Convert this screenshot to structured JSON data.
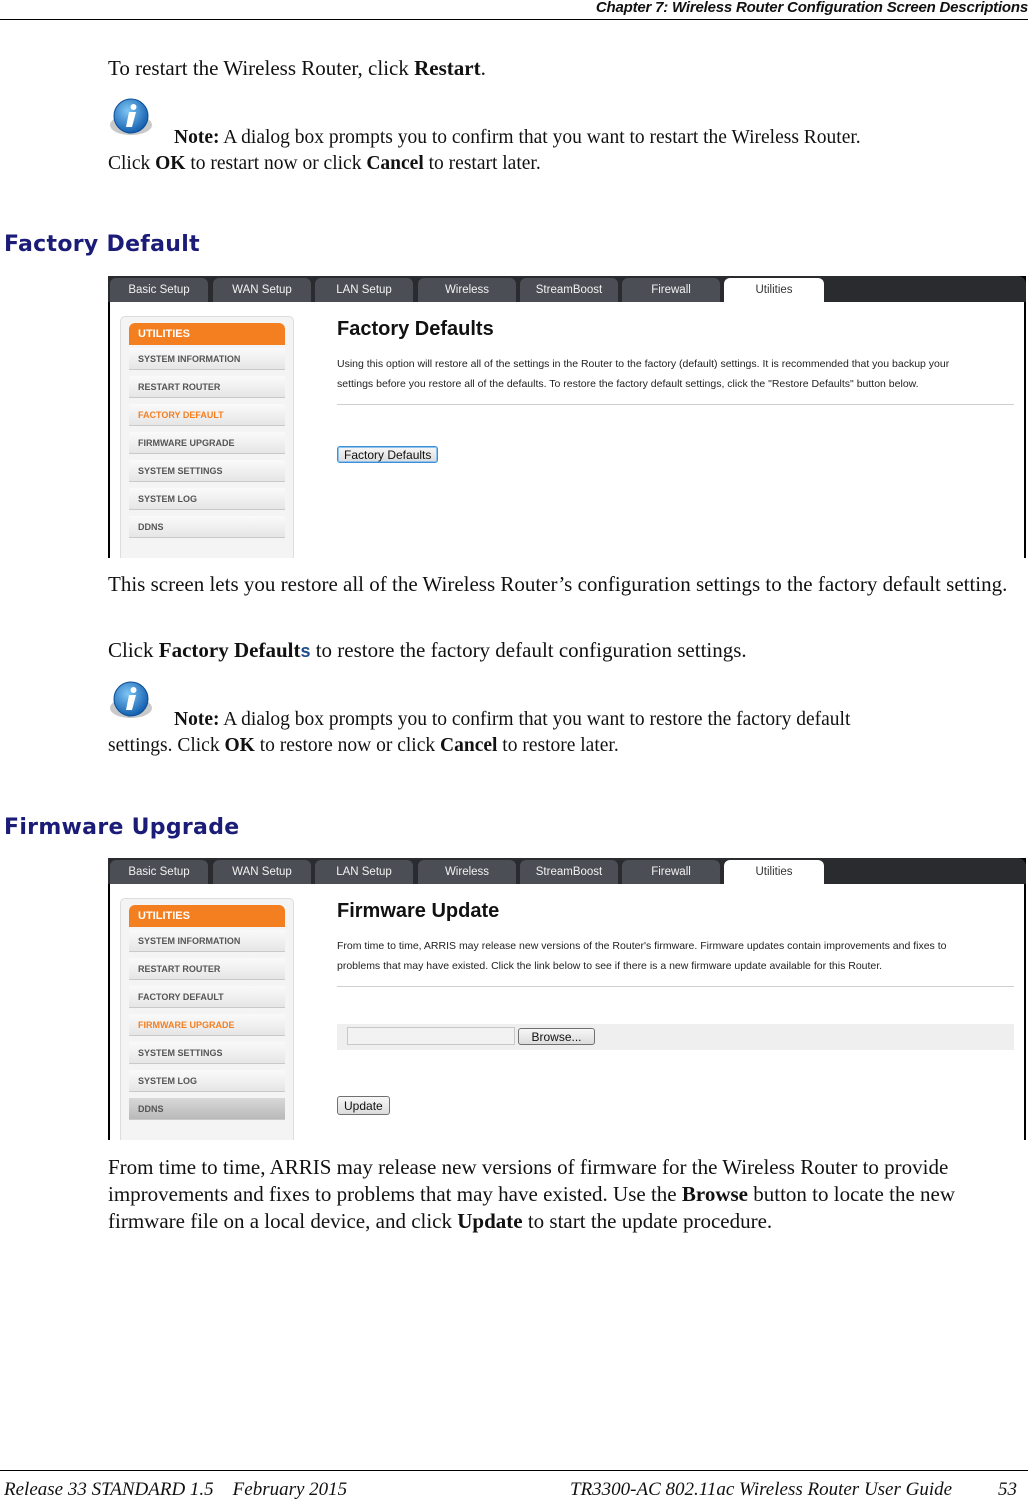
{
  "header": {
    "chapter": "Chapter 7: Wireless Router Configuration Screen Descriptions"
  },
  "restart": {
    "text_before": "To restart the Wireless Router, click ",
    "bold": "Restart",
    "text_after": ".",
    "note": {
      "label": "Note:",
      "line1": "  A dialog box prompts you to confirm that you want to restart the Wireless Router.",
      "click": "Click ",
      "ok": "OK",
      "mid": " to restart now or click ",
      "cancel": "Cancel",
      "end": " to restart later.",
      "icon": "info-icon"
    }
  },
  "factory_section": {
    "title": "Factory Default",
    "screenshot": {
      "tabs": [
        "Basic Setup",
        "WAN Setup",
        "LAN Setup",
        "Wireless",
        "StreamBoost",
        "Firewall",
        "Utilities"
      ],
      "active_tab": "Utilities",
      "sidebar_header": "UTILITIES",
      "sidebar_items": [
        "SYSTEM INFORMATION",
        "RESTART ROUTER",
        "FACTORY DEFAULT",
        "FIRMWARE UPGRADE",
        "SYSTEM SETTINGS",
        "SYSTEM LOG",
        "DDNS"
      ],
      "active_item": "FACTORY DEFAULT",
      "title": "Factory Defaults",
      "desc_line1": "Using this option will restore all of the settings in the Router to the factory (default) settings. It is recommended that you backup your",
      "desc_line2": "settings before you restore all of the defaults. To restore the factory default settings, click the \"Restore Defaults\" button below.",
      "button": "Factory Defaults"
    },
    "para1": "This screen lets you restore all of the Wireless Router’s configuration settings to the factory default setting.",
    "para2_before": "Click ",
    "para2_bold": "Factory Default",
    "para2_s": "s",
    "para2_after": " to restore the factory default configuration settings.",
    "note": {
      "label": "Note:",
      "line1": "  A dialog box prompts you to confirm that you want to restore the factory default",
      "start": "settings.  Click ",
      "ok": "OK",
      "mid": " to restore now or click ",
      "cancel": "Cancel",
      "end": " to restore later.",
      "icon": "info-icon"
    }
  },
  "firmware_section": {
    "title": "Firmware Upgrade",
    "screenshot": {
      "tabs": [
        "Basic Setup",
        "WAN Setup",
        "LAN Setup",
        "Wireless",
        "StreamBoost",
        "Firewall",
        "Utilities"
      ],
      "active_tab": "Utilities",
      "sidebar_header": "UTILITIES",
      "sidebar_items": [
        "SYSTEM INFORMATION",
        "RESTART ROUTER",
        "FACTORY DEFAULT",
        "FIRMWARE UPGRADE",
        "SYSTEM SETTINGS",
        "SYSTEM LOG",
        "DDNS"
      ],
      "active_item": "FIRMWARE UPGRADE",
      "title": "Firmware Update",
      "desc_line1": "From time to time, ARRIS may release new versions of the Router's firmware. Firmware updates contain improvements and fixes to",
      "desc_line2": "problems that may have existed. Click the link below to see if there is a new firmware update available for this Router.",
      "file_value": "",
      "browse_button": "Browse...",
      "update_button": "Update"
    },
    "para_a": "From time to time, ARRIS may release new versions of firmware for the Wireless Router to provide improvements and fixes to problems that may have existed. Use the ",
    "para_browse": "Browse",
    "para_b": " button to locate the new firmware file on a local device, and click ",
    "para_update": "Update",
    "para_c": " to start the update procedure."
  },
  "footer": {
    "left": "Release 33 STANDARD 1.5    February 2015",
    "right": "TR3300-AC 802.11ac Wireless Router User Guide",
    "page": "53"
  },
  "colors": {
    "accent_orange": "#f47f20",
    "section_blue": "#1b1b78",
    "tab_dark": "#4b4e55"
  }
}
